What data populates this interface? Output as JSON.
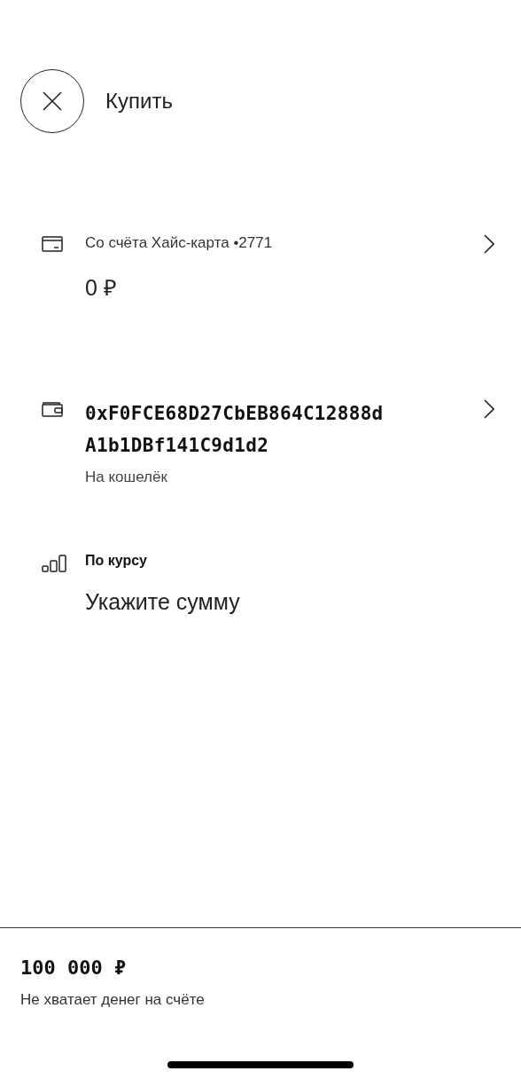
{
  "header": {
    "title": "Купить"
  },
  "rows": [
    {
      "kind": "account",
      "label": "Со счёта Хайс-карта •2771",
      "value": "0 ₽",
      "chevron": true
    },
    {
      "kind": "wallet",
      "address_lines": [
        "0xF0FCE68D27CbEB864C12888d",
        "A1b1DBf141C9d1d2"
      ],
      "caption": "На кошелёк",
      "chevron": true
    },
    {
      "kind": "rate",
      "label": "По курсу",
      "value": "Укажите сумму",
      "chevron": false
    }
  ],
  "footer": {
    "amount": "100 000 ₽",
    "message": "Не хватает денег на счёте"
  }
}
